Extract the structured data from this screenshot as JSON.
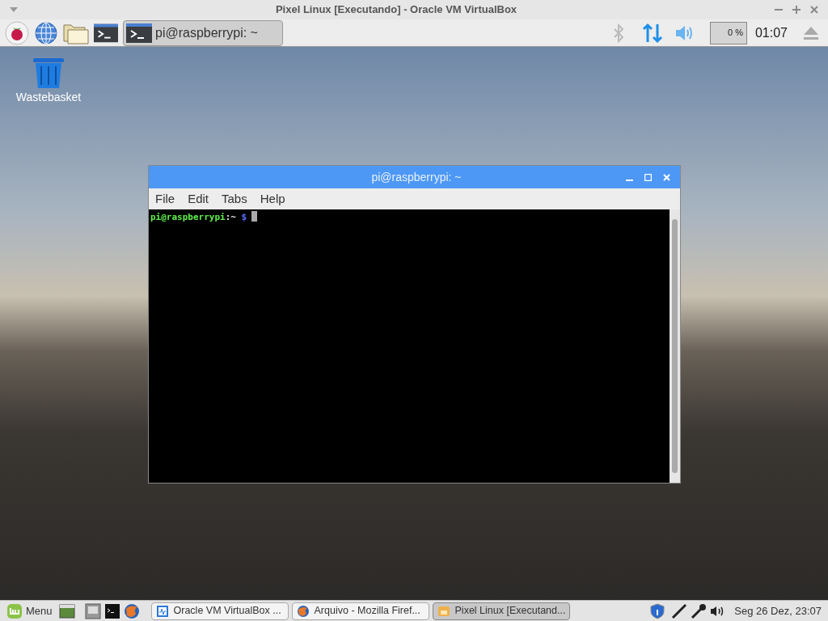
{
  "host_window": {
    "title": "Pixel Linux [Executando] - Oracle VM VirtualBox"
  },
  "guest_panel": {
    "tasks": [
      {
        "label": "pi@raspberrypi: ~",
        "selected": true
      }
    ],
    "cpu_reading": "0 %",
    "clock": "01:07"
  },
  "desktop": {
    "icons": [
      {
        "label": "Wastebasket"
      }
    ]
  },
  "terminal": {
    "title": "pi@raspberrypi: ~",
    "menu": [
      "File",
      "Edit",
      "Tabs",
      "Help"
    ],
    "prompt": {
      "user": "pi@raspberrypi",
      "path": ":~",
      "symbol": "$"
    }
  },
  "host_taskbar": {
    "menu_label": "Menu",
    "tasks": [
      {
        "kind": "vbox",
        "label": "Oracle VM VirtualBox ...",
        "selected": false
      },
      {
        "kind": "browser",
        "label": "Arquivo - Mozilla Firef...",
        "selected": false
      },
      {
        "kind": "vm",
        "label": "Pixel Linux [Executand...",
        "selected": true
      }
    ],
    "clock": "Seg 26 Dez, 23:07"
  }
}
